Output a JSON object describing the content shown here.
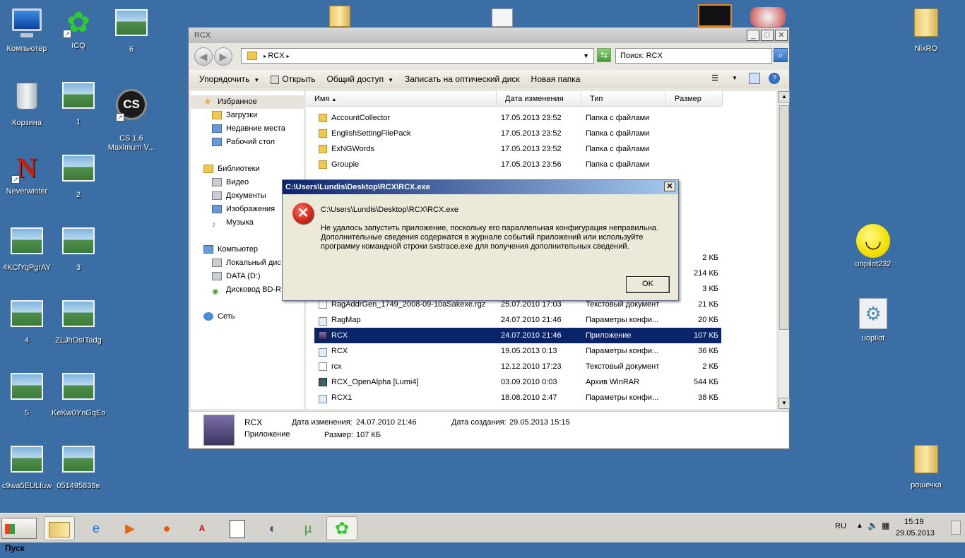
{
  "desktop": {
    "icons": [
      {
        "label": "Компьютер"
      },
      {
        "label": "ICQ"
      },
      {
        "label": "6"
      },
      {
        "label": "Корзина"
      },
      {
        "label": "1"
      },
      {
        "label": "CS 1.6\nMaximum V..."
      },
      {
        "label": "Neverwinter"
      },
      {
        "label": "2"
      },
      {
        "label": "4KCfYqPgrAY"
      },
      {
        "label": "3"
      },
      {
        "label": "4"
      },
      {
        "label": "ZLJhOsITadg"
      },
      {
        "label": "5"
      },
      {
        "label": "KeKw0YnGqEo"
      },
      {
        "label": "c9wa5EULfuw"
      },
      {
        "label": "051495838e"
      },
      {
        "label": "NixRO"
      },
      {
        "label": "uopilot232"
      },
      {
        "label": "uopilot"
      },
      {
        "label": "рошечка"
      }
    ]
  },
  "explorer": {
    "title": "RCX",
    "breadcrumb": "RCX",
    "search_placeholder": "Поиск: RCX",
    "toolbar": {
      "organize": "Упорядочить",
      "open": "Открыть",
      "share": "Общий доступ",
      "burn": "Записать на оптический диск",
      "new_folder": "Новая папка"
    },
    "nav": {
      "favorites": "Избранное",
      "downloads": "Загрузки",
      "recent": "Недавние места",
      "desktop": "Рабочий стол",
      "libraries": "Библиотеки",
      "video": "Видео",
      "documents": "Документы",
      "images": "Изображения",
      "music": "Музыка",
      "computer": "Компьютер",
      "local_disk": "Локальный дис",
      "data_disk": "DATA (D:)",
      "dvd": "Дисковод BD-R",
      "network": "Сеть"
    },
    "columns": {
      "name": "Имя",
      "date": "Дата изменения",
      "type": "Тип",
      "size": "Размер"
    },
    "rows": [
      {
        "name": "AccountCollector",
        "date": "17.05.2013 23:52",
        "type": "Папка с файлами",
        "size": ""
      },
      {
        "name": "EnglishSettingFilePack",
        "date": "17.05.2013 23:52",
        "type": "Папка с файлами",
        "size": ""
      },
      {
        "name": "ExNGWords",
        "date": "17.05.2013 23:52",
        "type": "Папка с файлами",
        "size": ""
      },
      {
        "name": "Groupie",
        "date": "17.05.2013 23:56",
        "type": "Папка с файлами",
        "size": ""
      },
      {
        "name": "",
        "date": "",
        "type": "",
        "size": "2 КБ"
      },
      {
        "name": "",
        "date": "",
        "type": "",
        "size": "214 КБ"
      },
      {
        "name": "",
        "date": "",
        "type": "",
        "size": "3 КБ"
      },
      {
        "name": "RagAddrGen_1749_2008-09-10aSakexe.rgz",
        "date": "25.07.2010 17:03",
        "type": "Текстовый документ",
        "size": "21 КБ"
      },
      {
        "name": "RagMap",
        "date": "24.07.2010 21:46",
        "type": "Параметры конфи...",
        "size": "20 КБ"
      },
      {
        "name": "RCX",
        "date": "24.07.2010 21:46",
        "type": "Приложение",
        "size": "107 КБ"
      },
      {
        "name": "RCX",
        "date": "19.05.2013 0:13",
        "type": "Параметры конфи...",
        "size": "36 КБ"
      },
      {
        "name": "rcx",
        "date": "12.12.2010 17:23",
        "type": "Текстовый документ",
        "size": "2 КБ"
      },
      {
        "name": "RCX_OpenAlpha [Lumi4]",
        "date": "03.09.2010 0:03",
        "type": "Архив WinRAR",
        "size": "544 КБ"
      },
      {
        "name": "RCX1",
        "date": "18.08.2010 2:47",
        "type": "Параметры конфи...",
        "size": "38 КБ"
      }
    ],
    "details": {
      "name": "RCX",
      "kind": "Приложение",
      "modified_label": "Дата изменения:",
      "modified": "24.07.2010 21:46",
      "created_label": "Дата создания:",
      "created": "29.05.2013 15:15",
      "size_label": "Размер:",
      "size": "107 КБ"
    }
  },
  "dialog": {
    "title": "C:\\Users\\Lundis\\Desktop\\RCX\\RCX.exe",
    "path": "C:\\Users\\Lundis\\Desktop\\RCX\\RCX.exe",
    "line1": "Не удалось запустить приложение, поскольку его параллельная конфигурация неправильна.",
    "line2": "Дополнительные сведения содержатся в журнале событий приложений или используйте",
    "line3": "программу командной строки sxstrace.exe для получения дополнительных сведений.",
    "ok": "OK",
    "close": "✕"
  },
  "taskbar": {
    "start": "Пуск",
    "lang": "RU",
    "time": "15:19",
    "date": "29.05.2013"
  }
}
